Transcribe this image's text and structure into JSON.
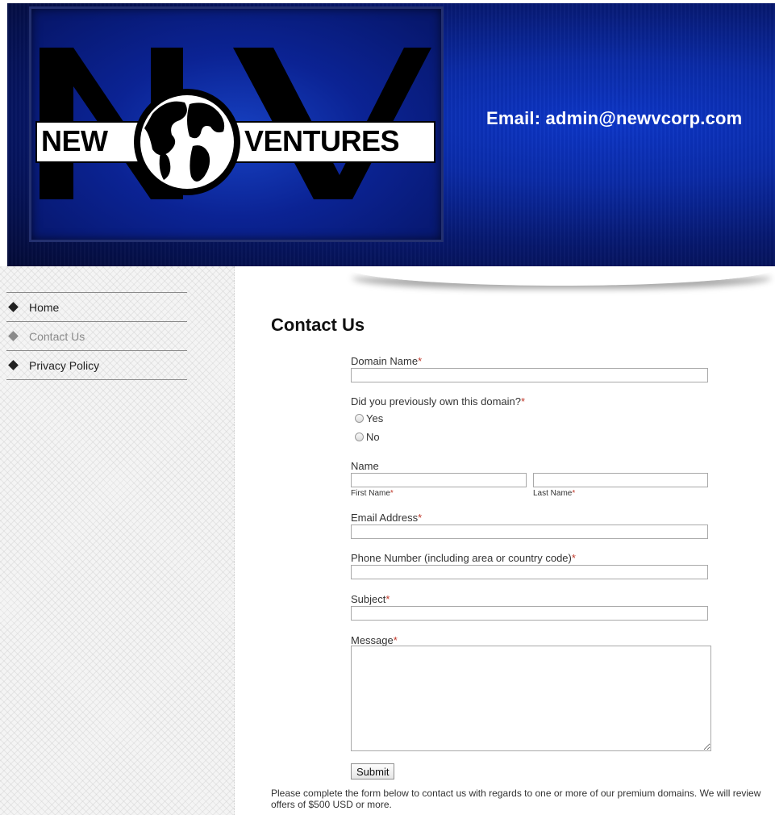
{
  "header": {
    "logo_word_left": "NEW",
    "logo_word_right": "VENTURES",
    "logo_letters": "NV",
    "email_text": "Email: admin@newvcorp.com"
  },
  "sidebar": {
    "items": [
      {
        "label": "Home",
        "active": false
      },
      {
        "label": "Contact Us",
        "active": true
      },
      {
        "label": "Privacy Policy",
        "active": false
      }
    ]
  },
  "page": {
    "title": "Contact Us"
  },
  "form": {
    "required_marker": "*",
    "domain_label": "Domain Name",
    "domain_value": "",
    "previously_owned_label": "Did you previously own this domain?",
    "radio_options": [
      "Yes",
      "No"
    ],
    "name_label": "Name",
    "first_name_label": "First Name",
    "last_name_label": "Last Name",
    "email_label": "Email Address",
    "phone_label": "Phone Number (including area or country code)",
    "subject_label": "Subject",
    "message_label": "Message",
    "submit_label": "Submit"
  },
  "footnote": "Please complete the form below to contact us with regards to one or more of our premium domains. We will review offers of $500 USD or more.",
  "colors": {
    "header_blue": "#0a2aa6",
    "required_red": "#c0392b"
  }
}
